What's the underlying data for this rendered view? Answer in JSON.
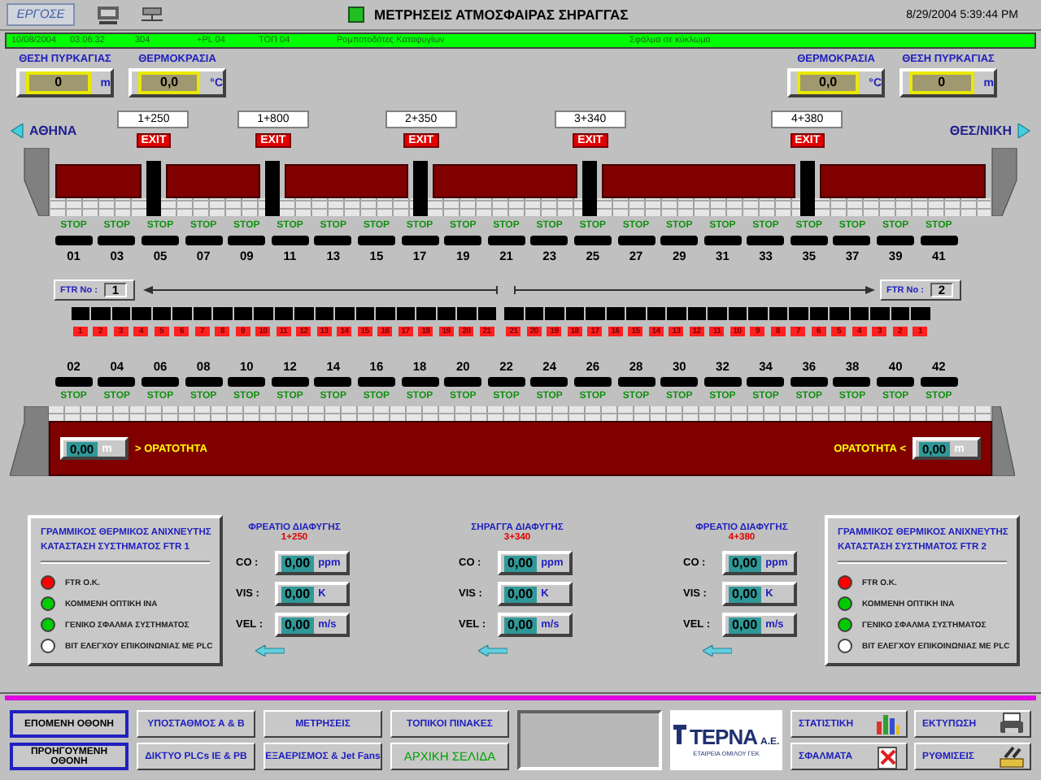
{
  "header": {
    "logo": "ΕΡΓΟΣΕ",
    "title": "ΜΕΤΡΗΣΕΙΣ ΑΤΜΟΣΦΑΙΡΑΣ ΣΗΡΑΓΓΑΣ",
    "datetime": "8/29/2004 5:39:44 PM"
  },
  "alarm_bar": [
    "10/08/2004",
    "03:06:32",
    "304",
    "+PL 04",
    "ΤΟΠ 04",
    "Ρομποτοδότες Καταφυγίων",
    "Σφάλμα σε κύκλωμα"
  ],
  "readouts": {
    "left": [
      {
        "label": "ΘΕΣΗ ΠΥΡΚΑΓΙΑΣ",
        "value": "0",
        "unit": "m"
      },
      {
        "label": "ΘΕΡΜΟΚΡΑΣΙΑ",
        "value": "0,0",
        "unit": "°C"
      }
    ],
    "right": [
      {
        "label": "ΘΕΡΜΟΚΡΑΣΙΑ",
        "value": "0,0",
        "unit": "°C"
      },
      {
        "label": "ΘΕΣΗ ΠΥΡΚΑΓΙΑΣ",
        "value": "0",
        "unit": "m"
      }
    ]
  },
  "tunnel": {
    "left_direction": "ΑΘΗΝΑ",
    "right_direction": "ΘΕΣ/ΝΙΚΗ",
    "exits": [
      {
        "chainage": "1+250",
        "label": "EXIT"
      },
      {
        "chainage": "1+800",
        "label": "EXIT"
      },
      {
        "chainage": "2+350",
        "label": "EXIT"
      },
      {
        "chainage": "3+340",
        "label": "EXIT"
      },
      {
        "chainage": "4+380",
        "label": "EXIT"
      }
    ]
  },
  "upper_sensors": [
    {
      "label": "STOP",
      "number": "01"
    },
    {
      "label": "STOP",
      "number": "03"
    },
    {
      "label": "STOP",
      "number": "05"
    },
    {
      "label": "STOP",
      "number": "07"
    },
    {
      "label": "STOP",
      "number": "09"
    },
    {
      "label": "STOP",
      "number": "11"
    },
    {
      "label": "STOP",
      "number": "13"
    },
    {
      "label": "STOP",
      "number": "15"
    },
    {
      "label": "STOP",
      "number": "17"
    },
    {
      "label": "STOP",
      "number": "19"
    },
    {
      "label": "STOP",
      "number": "21"
    },
    {
      "label": "STOP",
      "number": "23"
    },
    {
      "label": "STOP",
      "number": "25"
    },
    {
      "label": "STOP",
      "number": "27"
    },
    {
      "label": "STOP",
      "number": "29"
    },
    {
      "label": "STOP",
      "number": "31"
    },
    {
      "label": "STOP",
      "number": "33"
    },
    {
      "label": "STOP",
      "number": "35"
    },
    {
      "label": "STOP",
      "number": "37"
    },
    {
      "label": "STOP",
      "number": "39"
    },
    {
      "label": "STOP",
      "number": "41"
    }
  ],
  "ftr": {
    "left": {
      "label": "FTR No :",
      "value": "1"
    },
    "right": {
      "label": "FTR No :",
      "value": "2"
    },
    "left_zones": [
      "1",
      "2",
      "3",
      "4",
      "5",
      "6",
      "7",
      "8",
      "9",
      "10",
      "11",
      "12",
      "13",
      "14",
      "15",
      "16",
      "17",
      "18",
      "19",
      "20",
      "21"
    ],
    "right_zones": [
      "21",
      "20",
      "19",
      "18",
      "17",
      "16",
      "15",
      "14",
      "13",
      "12",
      "11",
      "10",
      "9",
      "8",
      "7",
      "6",
      "5",
      "4",
      "3",
      "2",
      "1"
    ]
  },
  "lower_sensors": [
    {
      "label": "STOP",
      "number": "02"
    },
    {
      "label": "STOP",
      "number": "04"
    },
    {
      "label": "STOP",
      "number": "06"
    },
    {
      "label": "STOP",
      "number": "08"
    },
    {
      "label": "STOP",
      "number": "10"
    },
    {
      "label": "STOP",
      "number": "12"
    },
    {
      "label": "STOP",
      "number": "14"
    },
    {
      "label": "STOP",
      "number": "16"
    },
    {
      "label": "STOP",
      "number": "18"
    },
    {
      "label": "STOP",
      "number": "20"
    },
    {
      "label": "STOP",
      "number": "22"
    },
    {
      "label": "STOP",
      "number": "24"
    },
    {
      "label": "STOP",
      "number": "26"
    },
    {
      "label": "STOP",
      "number": "28"
    },
    {
      "label": "STOP",
      "number": "30"
    },
    {
      "label": "STOP",
      "number": "32"
    },
    {
      "label": "STOP",
      "number": "34"
    },
    {
      "label": "STOP",
      "number": "36"
    },
    {
      "label": "STOP",
      "number": "38"
    },
    {
      "label": "STOP",
      "number": "40"
    },
    {
      "label": "STOP",
      "number": "42"
    }
  ],
  "visibility": {
    "left": {
      "value": "0,00",
      "unit": "m",
      "label": "> ΟΡΑΤΟΤΗΤΑ"
    },
    "right": {
      "label": "ΟΡΑΤΟΤΗΤΑ <",
      "value": "0,00",
      "unit": "m"
    }
  },
  "ftr_panels": [
    {
      "title": [
        "ΓΡΑΜΜΙΚΟΣ ΘΕΡΜΙΚΟΣ ΑΝΙΧΝΕΥΤΗΣ",
        "ΚΑΤΑΣΤΑΣΗ ΣΥΣΤΗΜΑΤΟΣ FTR 1"
      ],
      "indicators": [
        {
          "label": "FTR O.K.",
          "color": "#ff0000"
        },
        {
          "label": "ΚΟΜΜΕΝΗ ΟΠΤΙΚΗ ΙΝΑ",
          "color": "#00cc00"
        },
        {
          "label": "ΓΕΝΙΚΟ ΣΦΑΛΜΑ ΣΥΣΤΗΜΑΤΟΣ",
          "color": "#00cc00"
        },
        {
          "label": "BIT ΕΛΕΓΧΟΥ ΕΠΙΚΟΙΝΩΝΙΑΣ ΜΕ PLC",
          "color": "#ffffff"
        }
      ]
    },
    {
      "title": [
        "ΓΡΑΜΜΙΚΟΣ ΘΕΡΜΙΚΟΣ ΑΝΙΧΝΕΥΤΗΣ",
        "ΚΑΤΑΣΤΑΣΗ ΣΥΣΤΗΜΑΤΟΣ FTR 2"
      ],
      "indicators": [
        {
          "label": "FTR O.K.",
          "color": "#ff0000"
        },
        {
          "label": "ΚΟΜΜΕΝΗ ΟΠΤΙΚΗ ΙΝΑ",
          "color": "#00cc00"
        },
        {
          "label": "ΓΕΝΙΚΟ ΣΦΑΛΜΑ ΣΥΣΤΗΜΑΤΟΣ",
          "color": "#00cc00"
        },
        {
          "label": "BIT ΕΛΕΓΧΟΥ ΕΠΙΚΟΙΝΩΝΙΑΣ ΜΕ PLC",
          "color": "#ffffff"
        }
      ]
    }
  ],
  "shafts": [
    {
      "title": "ΦΡΕΑΤΙΟ ΔΙΑΦΥΓΗΣ",
      "chainage": "1+250",
      "readings": [
        {
          "label": "CO :",
          "value": "0,00",
          "unit": "ppm"
        },
        {
          "label": "VIS :",
          "value": "0,00",
          "unit": "K"
        },
        {
          "label": "VEL :",
          "value": "0,00",
          "unit": "m/s"
        }
      ]
    },
    {
      "title": "ΣΗΡΑΓΓΑ ΔΙΑΦΥΓΗΣ",
      "chainage": "3+340",
      "readings": [
        {
          "label": "CO :",
          "value": "0,00",
          "unit": "ppm"
        },
        {
          "label": "VIS :",
          "value": "0,00",
          "unit": "K"
        },
        {
          "label": "VEL :",
          "value": "0,00",
          "unit": "m/s"
        }
      ]
    },
    {
      "title": "ΦΡΕΑΤΙΟ ΔΙΑΦΥΓΗΣ",
      "chainage": "4+380",
      "readings": [
        {
          "label": "CO :",
          "value": "0,00",
          "unit": "ppm"
        },
        {
          "label": "VIS :",
          "value": "0,00",
          "unit": "K"
        },
        {
          "label": "VEL :",
          "value": "0,00",
          "unit": "m/s"
        }
      ]
    }
  ],
  "bottom_bar": {
    "buttons": [
      {
        "label": "ΕΠΟΜΕΝΗ ΟΘΟΝΗ",
        "kind": "nav"
      },
      {
        "label": "ΥΠΟΣΤΑΘΜΟΣ Α & Β",
        "kind": "menu"
      },
      {
        "label": "ΜΕΤΡΗΣΕΙΣ",
        "kind": "menu"
      },
      {
        "label": "ΤΟΠΙΚΟΙ ΠΙΝΑΚΕΣ",
        "kind": "menu"
      },
      {
        "label": "ΠΡΟΗΓΟΥΜΕΝΗ ΟΘΟΝΗ",
        "kind": "nav"
      },
      {
        "label": "ΔΙΚΤΥΟ PLCs ΙΕ & PB",
        "kind": "menu"
      },
      {
        "label": "ΕΞΑΕΡΙΣΜΟΣ & Jet Fans",
        "kind": "menu"
      },
      {
        "label": "ΑΡΧΙΚΗ ΣΕΛΙΔΑ",
        "kind": "home"
      }
    ],
    "logo": {
      "name": "ΤΕΡΝΑ",
      "suffix": "Α.Ε.",
      "subtitle": "ΕΤΑΙΡΕΙΑ ΟΜΙΛΟΥ ΓΕΚ"
    },
    "tools": [
      {
        "label": "ΣΤΑΤΙΣΤΙΚΗ"
      },
      {
        "label": "ΕΚΤΥΠΩΣΗ"
      },
      {
        "label": "ΣΦΑΛΜΑΤΑ"
      },
      {
        "label": "ΡΥΘΜΙΣΕΙΣ"
      }
    ]
  }
}
